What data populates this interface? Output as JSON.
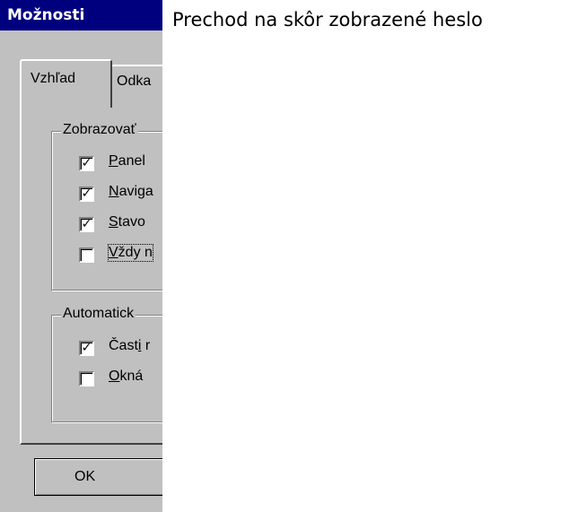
{
  "caption": "Prechod na skôr zobrazené heslo",
  "dialog": {
    "title": "Možnosti",
    "tabs": [
      {
        "label": "Vzhľad",
        "active": true
      },
      {
        "label": "Odka",
        "active": false
      }
    ],
    "group_display": {
      "label": "Zobrazovať",
      "items": [
        {
          "pre": "",
          "key": "P",
          "rest": "anel",
          "checked": "✓"
        },
        {
          "pre": "",
          "key": "N",
          "rest": "aviga",
          "checked": "✓"
        },
        {
          "pre": "",
          "key": "S",
          "rest": "tavo",
          "checked": "✓"
        },
        {
          "pre": "",
          "key": "V",
          "rest": "ždy n",
          "checked": ""
        }
      ]
    },
    "group_auto": {
      "label": "Automatick",
      "items": [
        {
          "pre": "Čast",
          "key": "i",
          "rest": " r",
          "checked": "✓"
        },
        {
          "pre": "",
          "key": "O",
          "rest": "kná",
          "checked": ""
        }
      ]
    },
    "ok_label": "OK"
  }
}
